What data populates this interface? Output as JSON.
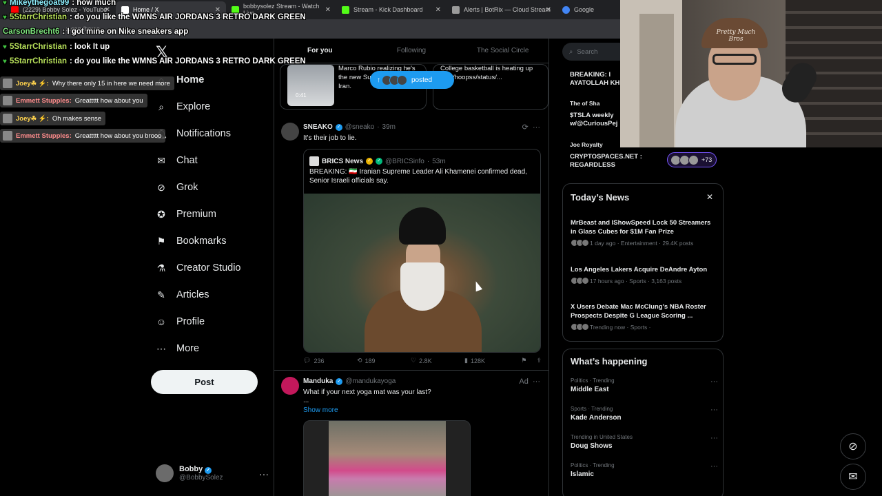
{
  "browser": {
    "tabs": [
      {
        "label": "(2229) Bobby Solez - YouTube",
        "color": "#ff0000",
        "active": false
      },
      {
        "label": "Home / X",
        "color": "#ffffff",
        "active": true
      },
      {
        "label": "bobbysolez Stream - Watch Live",
        "color": "#53fc18",
        "active": false
      },
      {
        "label": "Stream - Kick Dashboard",
        "color": "#53fc18",
        "active": false
      },
      {
        "label": "Alerts | BotRix — Cloud Stream",
        "color": "#9b9b9b",
        "active": false
      },
      {
        "label": "Google",
        "color": "#4285f4",
        "active": false
      }
    ],
    "url": "x.com/home"
  },
  "nav": {
    "items": [
      {
        "key": "home",
        "label": "Home",
        "icon": "⌂"
      },
      {
        "key": "explore",
        "label": "Explore",
        "icon": "⌕"
      },
      {
        "key": "notifications",
        "label": "Notifications",
        "icon": "🔔︎"
      },
      {
        "key": "chat",
        "label": "Chat",
        "icon": "✉"
      },
      {
        "key": "grok",
        "label": "Grok",
        "icon": "⊘"
      },
      {
        "key": "premium",
        "label": "Premium",
        "icon": "✪"
      },
      {
        "key": "bookmarks",
        "label": "Bookmarks",
        "icon": "⚑"
      },
      {
        "key": "creator-studio",
        "label": "Creator Studio",
        "icon": "⚗"
      },
      {
        "key": "articles",
        "label": "Articles",
        "icon": "✎"
      },
      {
        "key": "profile",
        "label": "Profile",
        "icon": "☺"
      },
      {
        "key": "more",
        "label": "More",
        "icon": "⋯"
      }
    ],
    "post_label": "Post",
    "account": {
      "name": "Bobby",
      "handle": "@BobbySolez"
    }
  },
  "feed": {
    "tabs": [
      "For you",
      "Following",
      "The Social Circle"
    ],
    "preview": {
      "left_text": "Marco Rubio realizing he's the new Supreme Leader of Iran.",
      "duration": "0:41",
      "right_text": "College basketball is heating up com/hoopss/status/..."
    },
    "posted_label": "posted",
    "tweet1": {
      "name": "SNEAKO",
      "handle": "@sneako",
      "time": "39m",
      "text": "It's their job to lie.",
      "quote": {
        "name": "BRICS News",
        "handle": "@BRICSinfo",
        "time": "53m",
        "text": "BREAKING: 🇮🇷 Iranian Supreme Leader Ali Khamenei confirmed dead, Senior Israeli officials say."
      },
      "stats": {
        "replies": "236",
        "reposts": "189",
        "likes": "2.8K",
        "views": "128K"
      }
    },
    "tweet2": {
      "name": "Manduka",
      "handle": "@mandukayoga",
      "ad": "Ad",
      "text": "What if your next yoga mat was your last?",
      "ellipsis": "...",
      "show_more": "Show more"
    }
  },
  "right": {
    "search_placeholder": "Search",
    "top_trends": [
      {
        "text": "BREAKING: I AYATOLLAH KH"
      },
      {
        "text": "The    of Sha"
      },
      {
        "text": "$TSLA weekly w/@CuriousPej"
      },
      {
        "text": "Joe Royalty"
      },
      {
        "text": "CRYPTOSPACES.NET : REGARDLESS"
      }
    ],
    "badge_count": "+73",
    "todays_news": {
      "title": "Today’s News",
      "items": [
        {
          "headline": "MrBeast and IShowSpeed Lock 50 Streamers in Glass Cubes for $1M Fan Prize",
          "meta": "1 day ago · Entertainment · 29.4K posts"
        },
        {
          "headline": "Los Angeles Lakers Acquire DeAndre Ayton",
          "meta": "17 hours ago · Sports · 3,163 posts"
        },
        {
          "headline": "X Users Debate Mac McClung's NBA Roster Prospects Despite G League Scoring ...",
          "meta": "Trending now · Sports ·"
        }
      ]
    },
    "whats_happening": {
      "title": "What’s happening",
      "items": [
        {
          "context": "Politics · Trending",
          "topic": "Middle East"
        },
        {
          "context": "Sports · Trending",
          "topic": "Kade Anderson"
        },
        {
          "context": "Trending in United States",
          "topic": "Doug Shows"
        },
        {
          "context": "Politics · Trending",
          "topic": "Islamic"
        }
      ]
    }
  },
  "webcam": {
    "cap_text": "Pretty Much Bros"
  },
  "chat": {
    "lines": [
      {
        "user": "Mikeythegoat99",
        "msg": ": how much"
      },
      {
        "user": "5StarrChristian",
        "msg": ": do you like the WMNS AIR JORDANS 3 RETRO DARK GREEN"
      },
      {
        "user": "CarsonBrecht6",
        "msg": ": I got mine on Nike sneakers app"
      },
      {
        "user": "5StarrChristian",
        "msg": ": look It up"
      },
      {
        "user": "5StarrChristian",
        "msg": ": do you like the WMNS AIR JORDANS 3 RETRO DARK GREEN"
      }
    ],
    "pills": [
      {
        "user": "Joey☘ ⚡:",
        "msg": "Why there only 15 in here we need more"
      },
      {
        "user": "Emmett Stupples:",
        "msg": "Greattttt how about you"
      },
      {
        "user": "Joey☘ ⚡:",
        "msg": "Oh makes sense"
      },
      {
        "user": "Emmett Stupples:",
        "msg": "Greattttt how about you brooo"
      }
    ]
  }
}
